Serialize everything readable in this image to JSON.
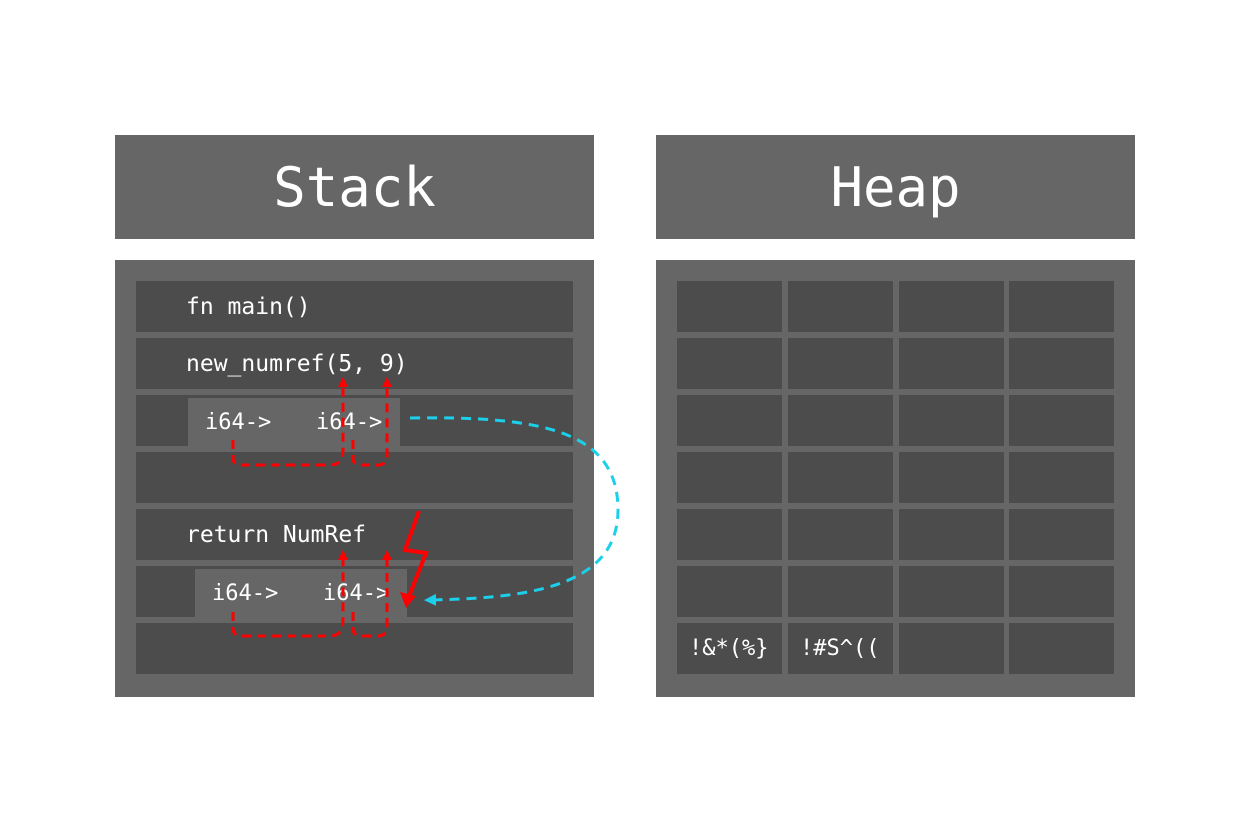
{
  "stack": {
    "title": "Stack",
    "rows": [
      "fn main()",
      "new_numref(5, 9)",
      "",
      "",
      "return NumRef",
      "",
      ""
    ],
    "value_labels": [
      "i64->",
      "i64->"
    ]
  },
  "heap": {
    "title": "Heap",
    "values": [
      "!&*(%}",
      "!#S^(("
    ]
  },
  "colors": {
    "panel": "#666666",
    "slot": "#4c4c4c",
    "ownership_arrow": "#ff0000",
    "move_arrow": "#1ccfea"
  }
}
